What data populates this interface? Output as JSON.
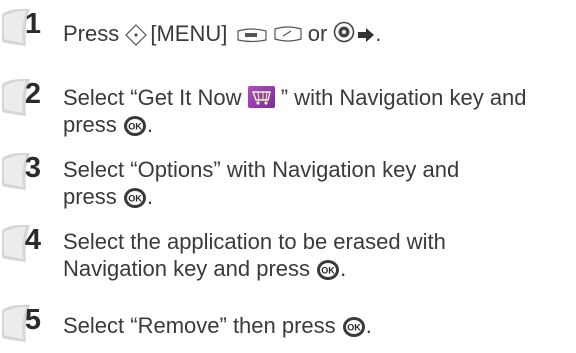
{
  "steps": [
    {
      "number": "1",
      "text_before": "Press ",
      "menu_label": "[MENU]",
      "or_label": " or ",
      "end": "."
    },
    {
      "number": "2",
      "line1_before": "Select “Get It Now ",
      "line1_after": " ” with Navigation key and",
      "line2_before": "press ",
      "line2_after": "."
    },
    {
      "number": "3",
      "line1": "Select “Options” with Navigation key and",
      "line2_before": "press ",
      "line2_after": "."
    },
    {
      "number": "4",
      "line1": "Select the application to be erased with",
      "line2_before": "Navigation key and press ",
      "line2_after": "."
    },
    {
      "number": "5",
      "line1_before": "Select “Remove” then press ",
      "line1_after": "."
    }
  ],
  "icons": {
    "ok_key": "ok-key-icon",
    "nav_key": "navigation-key-icon",
    "get_it_now": "get-it-now-icon",
    "menu_soft_key": "soft-key-icon",
    "arrow": "right-arrow-icon"
  },
  "colors": {
    "text": "#3a3a3a",
    "badge_shadow": "#c8c8c8",
    "get_it_now": "#9a35b5"
  }
}
